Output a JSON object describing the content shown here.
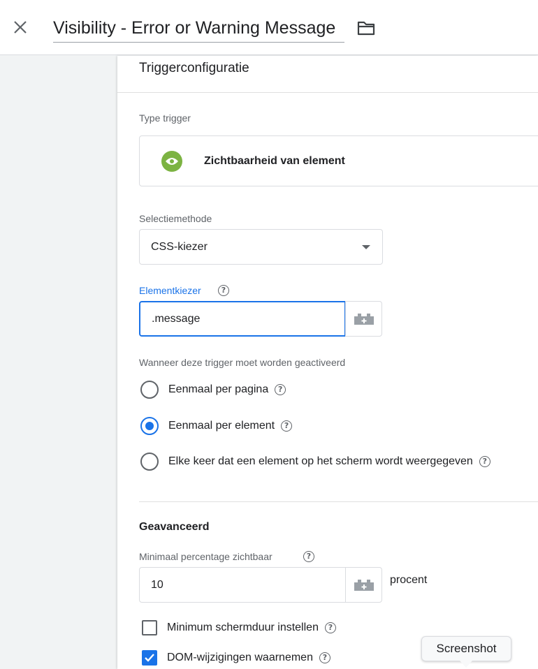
{
  "header": {
    "title": "Visibility - Error or Warning Message"
  },
  "panel": {
    "section_title": "Triggerconfiguratie",
    "type_label": "Type trigger",
    "type_name": "Zichtbaarheid van element",
    "selection_method_label": "Selectiemethode",
    "selection_method_value": "CSS-kiezer",
    "element_selector_label": "Elementkiezer",
    "element_selector_value": ".message",
    "fire_label": "Wanneer deze trigger moet worden geactiveerd",
    "fire_options": [
      {
        "label": "Eenmaal per pagina",
        "checked": false
      },
      {
        "label": "Eenmaal per element",
        "checked": true
      },
      {
        "label": "Elke keer dat een element op het scherm wordt weergegeven",
        "checked": false
      }
    ],
    "advanced_title": "Geavanceerd",
    "min_percent_label": "Minimaal percentage zichtbaar",
    "min_percent_value": "10",
    "min_percent_suffix": "procent",
    "checkboxes": [
      {
        "label": "Minimum schermduur instellen",
        "checked": false
      },
      {
        "label": "DOM-wijzigingen waarnemen",
        "checked": true
      }
    ]
  },
  "tooltip": {
    "text": "Screenshot"
  },
  "colors": {
    "accent": "#1a73e8",
    "trigger_icon": "#7cb342"
  },
  "icons": {
    "close": "close-icon",
    "folder": "folder-icon",
    "eye": "eye-icon",
    "caret": "chevron-down-icon",
    "variable": "variable-brick-icon",
    "help": "help-icon"
  }
}
